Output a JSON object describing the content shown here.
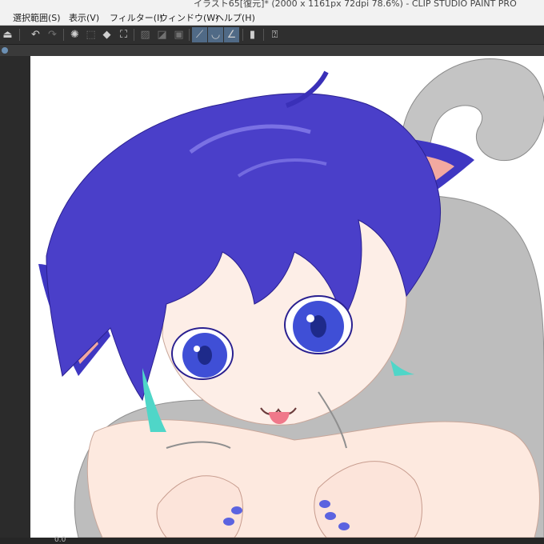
{
  "window": {
    "title": "イラスト65[復元]* (2000 x 1161px 72dpi 78.6%)  - CLIP STUDIO PAINT PRO"
  },
  "menu": [
    {
      "label": "選択範囲(S)"
    },
    {
      "label": "表示(V)"
    },
    {
      "label": "フィルター(I)"
    },
    {
      "label": "ウィンドウ(W)"
    },
    {
      "label": "ヘルプ(H)"
    }
  ],
  "toolbar": {
    "icons": [
      "layer-tool-icon",
      "undo-icon",
      "redo-icon",
      "loading-spinner-icon",
      "deselect-icon",
      "fill-icon",
      "crop-icon",
      "clear-icon",
      "invert-icon",
      "frame-icon",
      "brush-snap-icon",
      "curve-snap-icon",
      "ruler-snap-icon",
      "device-icon",
      "help-icon"
    ]
  },
  "status": {
    "zoom": "0.0"
  },
  "colors": {
    "hair": "#4a3fc9",
    "hair_dark": "#2a2090",
    "skin": "#fbe6dc",
    "ear_inner": "#f2a9a0",
    "eye": "#3f4fd6",
    "teal": "#4fd6c8",
    "hoodie": "#bdbdbd",
    "nail": "#5b63e0"
  }
}
